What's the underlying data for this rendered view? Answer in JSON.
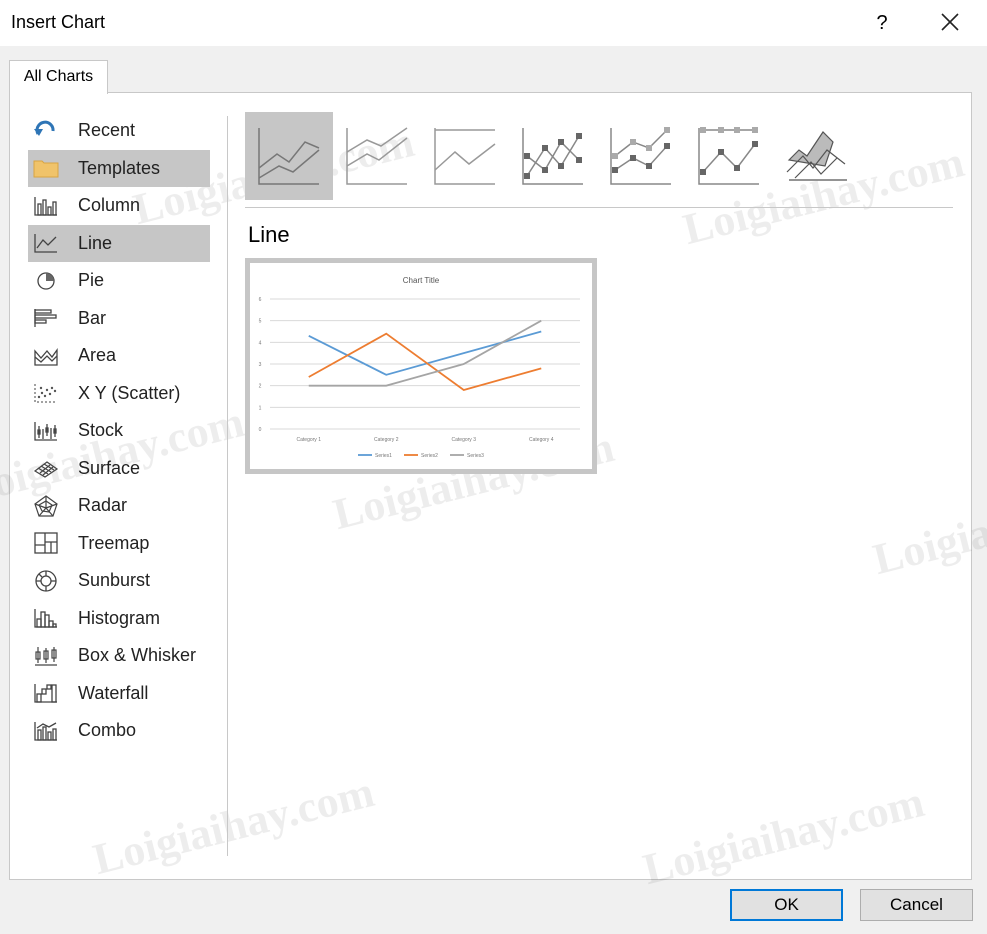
{
  "window": {
    "title": "Insert Chart",
    "help_label": "?"
  },
  "tabs": [
    {
      "label": "All Charts"
    }
  ],
  "sidebar": {
    "items": [
      {
        "label": "Recent",
        "icon": "recent-icon"
      },
      {
        "label": "Templates",
        "icon": "folder-icon",
        "selected": true
      },
      {
        "label": "Column",
        "icon": "column-chart-icon"
      },
      {
        "label": "Line",
        "icon": "line-chart-icon",
        "selected": true
      },
      {
        "label": "Pie",
        "icon": "pie-chart-icon"
      },
      {
        "label": "Bar",
        "icon": "bar-chart-icon"
      },
      {
        "label": "Area",
        "icon": "area-chart-icon"
      },
      {
        "label": "X Y (Scatter)",
        "icon": "scatter-chart-icon"
      },
      {
        "label": "Stock",
        "icon": "stock-chart-icon"
      },
      {
        "label": "Surface",
        "icon": "surface-chart-icon"
      },
      {
        "label": "Radar",
        "icon": "radar-chart-icon"
      },
      {
        "label": "Treemap",
        "icon": "treemap-chart-icon"
      },
      {
        "label": "Sunburst",
        "icon": "sunburst-chart-icon"
      },
      {
        "label": "Histogram",
        "icon": "histogram-chart-icon"
      },
      {
        "label": "Box & Whisker",
        "icon": "box-whisker-chart-icon"
      },
      {
        "label": "Waterfall",
        "icon": "waterfall-chart-icon"
      },
      {
        "label": "Combo",
        "icon": "combo-chart-icon"
      }
    ]
  },
  "subtypes": [
    {
      "icon": "line-icon",
      "selected": true
    },
    {
      "icon": "stacked-line-icon"
    },
    {
      "icon": "100-stacked-line-icon"
    },
    {
      "icon": "line-with-markers-icon"
    },
    {
      "icon": "stacked-line-with-markers-icon"
    },
    {
      "icon": "100-stacked-line-with-markers-icon"
    },
    {
      "icon": "3d-line-icon"
    }
  ],
  "section_title": "Line",
  "preview_chart": {
    "chart_data": {
      "type": "line",
      "title": "Chart Title",
      "categories": [
        "Category 1",
        "Category 2",
        "Category 3",
        "Category 4"
      ],
      "series": [
        {
          "name": "Series1",
          "values": [
            4.3,
            2.5,
            3.5,
            4.5
          ],
          "color": "#5b9bd5"
        },
        {
          "name": "Series2",
          "values": [
            2.4,
            4.4,
            1.8,
            2.8
          ],
          "color": "#ed7d31"
        },
        {
          "name": "Series3",
          "values": [
            2,
            2,
            3,
            5
          ],
          "color": "#a5a5a5"
        }
      ],
      "ylim": [
        0,
        6
      ],
      "yticks": [
        "0",
        "1",
        "2",
        "3",
        "4",
        "5",
        "6"
      ],
      "grid": true,
      "legend": "bottom"
    }
  },
  "watermark": "Loigiaihay.com",
  "buttons": {
    "ok": "OK",
    "cancel": "Cancel"
  },
  "colors": {
    "accent": "#0078d7",
    "selected": "#c6c6c6"
  }
}
